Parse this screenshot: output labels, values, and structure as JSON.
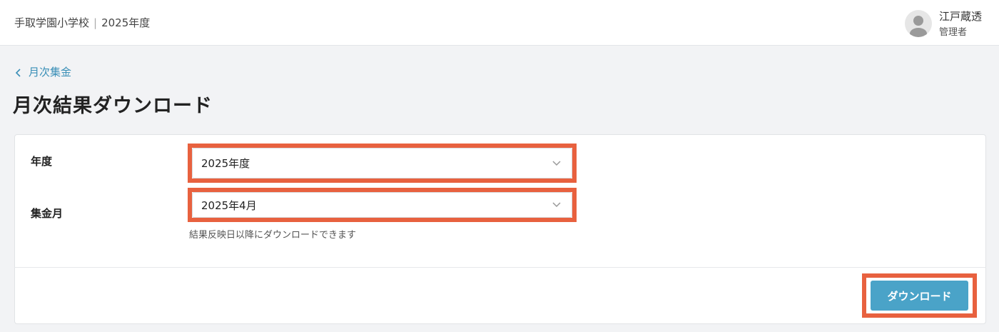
{
  "header": {
    "school_name": "手取学園小学校",
    "separator": "|",
    "year": "2025年度",
    "user_name": "江戸蔵透",
    "user_role": "管理者"
  },
  "breadcrumb": {
    "back_label": "月次集金",
    "back_icon": "chevron-left-icon"
  },
  "page": {
    "title": "月次結果ダウンロード"
  },
  "form": {
    "year_label": "年度",
    "year_value": "2025年度",
    "month_label": "集金月",
    "month_value": "2025年4月",
    "hint": "結果反映日以降にダウンロードできます"
  },
  "actions": {
    "download_label": "ダウンロード"
  },
  "colors": {
    "accent": "#4aa3c8",
    "link": "#3a8fb7",
    "highlight": "#e8613f"
  }
}
